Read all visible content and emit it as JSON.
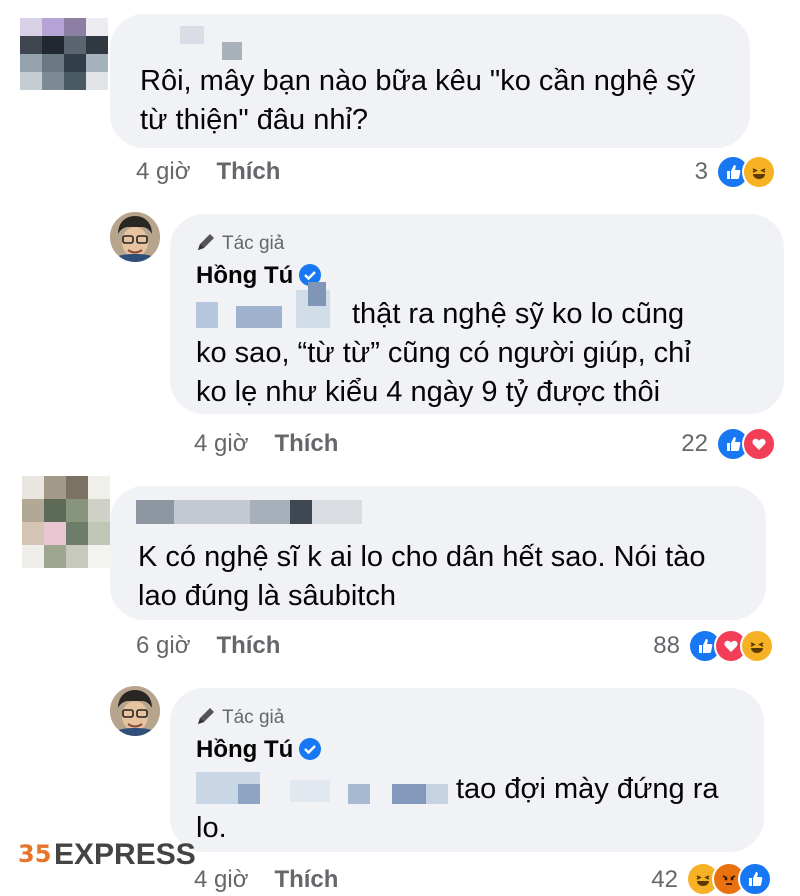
{
  "comments": [
    {
      "text_lines": [
        "Rôi, mây bạn nào bữa kêu \"ko cần nghệ sỹ",
        "từ thiện\" đâu nhỉ?"
      ],
      "time": "4 giờ",
      "like_label": "Thích",
      "reaction_count": "3",
      "reactions": [
        "like-icon",
        "haha-icon"
      ]
    },
    {
      "author_badge": "Tác giả",
      "author_name": "Hồng Tú",
      "text_lines": [
        "thật ra nghệ sỹ ko lo cũng",
        "ko sao, “từ từ” cũng có người giúp, chỉ",
        "ko lẹ như kiểu 4 ngày 9 tỷ được thôi"
      ],
      "time": "4 giờ",
      "like_label": "Thích",
      "reaction_count": "22",
      "reactions": [
        "like-icon",
        "love-icon"
      ]
    },
    {
      "text_lines": [
        "K có nghệ sĩ k ai lo cho dân hết sao. Nói tào",
        "lao đúng là sâubitch"
      ],
      "time": "6 giờ",
      "like_label": "Thích",
      "reaction_count": "88",
      "reactions": [
        "like-icon",
        "love-icon",
        "haha-icon"
      ]
    },
    {
      "author_badge": "Tác giả",
      "author_name": "Hồng Tú",
      "text_lines": [
        "tao đợi mày đứng ra",
        "lo."
      ],
      "time": "4 giờ",
      "like_label": "Thích",
      "reaction_count": "42",
      "reactions": [
        "haha-icon",
        "angry-icon",
        "like-icon"
      ]
    }
  ],
  "watermark": "EXPRESS",
  "colors": {
    "bubble": "#f0f2f5",
    "like_blue": "#1877f2",
    "love_red": "#f33e58",
    "haha_yellow": "#f7b125",
    "meta_gray": "#65676b"
  }
}
